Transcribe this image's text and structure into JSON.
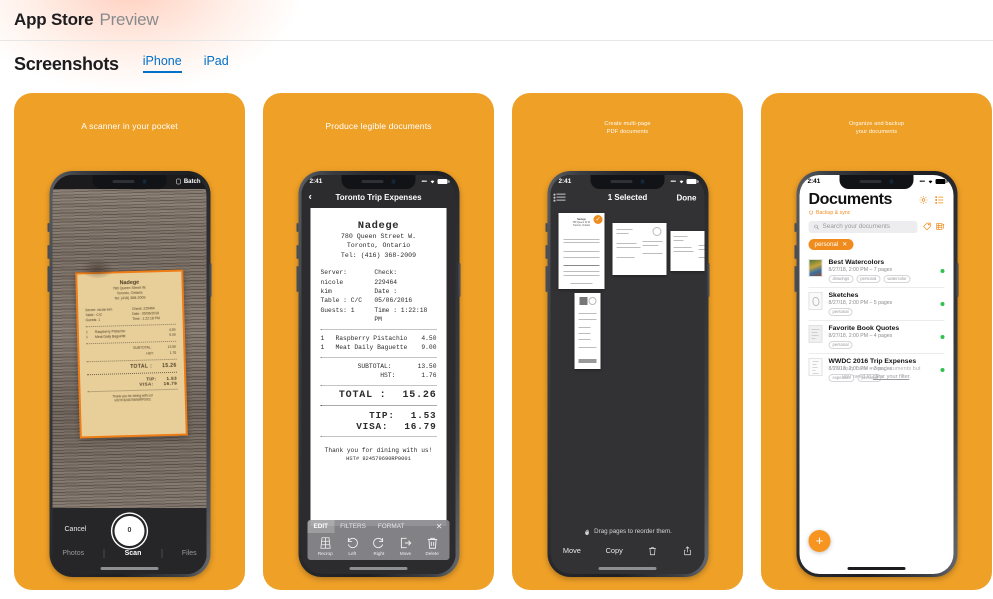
{
  "header": {
    "brand": "App Store",
    "section": "Preview"
  },
  "screenshots_section": {
    "title": "Screenshots",
    "tabs": [
      {
        "label": "iPhone",
        "active": true
      },
      {
        "label": "iPad",
        "active": false
      }
    ]
  },
  "theme": {
    "brand_orange": "#EFA027",
    "accent_orange": "#F08C1E",
    "link_blue": "#0070C9",
    "status_green": "#2FC04F"
  },
  "cards": [
    {
      "caption": "A scanner in your pocket",
      "screen": {
        "type": "camera-scanner",
        "topbar_button": "Batch",
        "cancel_label": "Cancel",
        "shutter_count": "0",
        "tabs": [
          "Photos",
          "Scan",
          "Files"
        ],
        "active_tab": "Scan",
        "receipt": {
          "title": "Nadege",
          "address1": "780 Queen Street W.",
          "address2": "Toronto, Ontario",
          "phone": "Tel: (416) 368-2009",
          "server": "Server: nicole kim",
          "table": "Table : C/C",
          "guests": "Guests: 1",
          "check": "Check: 229464",
          "date": "Date : 05/06/2016",
          "time": "Time : 1:22:18 PM",
          "items": [
            {
              "qty": "1",
              "name": "Raspberry Pistachio",
              "price": "4.50"
            },
            {
              "qty": "1",
              "name": "Meat Daily Baguette",
              "price": "9.00"
            }
          ],
          "subtotal_label": "SUBTOTAL:",
          "subtotal": "13.50",
          "hst_label": "HST:",
          "hst": "1.76",
          "total_label": "TOTAL :",
          "total": "15.26",
          "tip_label": "TIP:",
          "tip": "1.53",
          "visa_label": "VISA:",
          "visa": "16.79",
          "thanks": "Thank you for dining with us!",
          "hst_number": "HST# 824579690RP0001"
        }
      }
    },
    {
      "caption": "Produce legible documents",
      "screen": {
        "type": "document-viewer",
        "status_time": "2:41",
        "nav_title": "Toronto Trip Expenses",
        "toolbar_tabs": [
          "EDIT",
          "FILTERS",
          "FORMAT"
        ],
        "toolbar_active": "EDIT",
        "toolbar_actions": [
          {
            "label": "Recrop",
            "icon": "crop-icon"
          },
          {
            "label": "Left",
            "icon": "rotate-left-icon"
          },
          {
            "label": "Right",
            "icon": "rotate-right-icon"
          },
          {
            "label": "Move",
            "icon": "move-icon"
          },
          {
            "label": "Delete",
            "icon": "trash-icon"
          }
        ],
        "receipt": {
          "title": "Nadege",
          "address1": "780 Queen Street W.",
          "address2": "Toronto, Ontario",
          "phone": "Tel: (416) 368-2009",
          "server": "Server: nicole kim",
          "table": "Table : C/C",
          "guests": "Guests: 1",
          "check": "Check: 229464",
          "date": "Date : 05/06/2016",
          "time": "Time : 1:22:18 PM",
          "items": [
            {
              "qty": "1",
              "name": "Raspberry Pistachio",
              "price": "4.50"
            },
            {
              "qty": "1",
              "name": "Meat Daily Baguette",
              "price": "9.00"
            }
          ],
          "subtotal_label": "SUBTOTAL:",
          "subtotal": "13.50",
          "hst_label": "HST:",
          "hst": "1.76",
          "total_label": "TOTAL :",
          "total": "15.26",
          "tip_label": "TIP:",
          "tip": "1.53",
          "visa_label": "VISA:",
          "visa": "16.79",
          "thanks": "Thank you for dining with us!",
          "hst_number": "HST# 824579690RP0001"
        }
      }
    },
    {
      "caption": "Create multi-page\nPDF documents",
      "caption_line1": "Create multi-page",
      "caption_line2": "PDF documents",
      "screen": {
        "type": "pages-grid",
        "status_time": "2:41",
        "nav_title": "1 Selected",
        "done_label": "Done",
        "hint": "Drag pages to reorder them.",
        "bottom_actions": [
          "Move",
          "Copy"
        ],
        "page_count": 4,
        "selected_index": 0
      }
    },
    {
      "caption": "Organize and backup\nyour documents",
      "caption_line1": "Organize and backup",
      "caption_line2": "your documents",
      "screen": {
        "type": "documents-list",
        "status_time": "2:41",
        "title": "Documents",
        "sync_label": "Backup & sync",
        "search_placeholder": "Search your documents",
        "filter_chip": "personal",
        "documents": [
          {
            "name": "Best Watercolors",
            "meta": "8/27/18, 2:00 PM – 7 pages",
            "tags": [
              "drawings",
              "personal",
              "watercolor"
            ]
          },
          {
            "name": "Sketches",
            "meta": "8/27/18, 2:00 PM – 5 pages",
            "tags": [
              "personal"
            ]
          },
          {
            "name": "Favorite Book Quotes",
            "meta": "8/27/18, 2:00 PM – 4 pages",
            "tags": [
              "personal"
            ]
          },
          {
            "name": "WWDC 2016 Trip Expenses",
            "meta": "8/27/18, 2:00 PM – 3 pages",
            "tags": [
              "expenses",
              "personal"
            ]
          }
        ],
        "empty_note_line1": "You may have more documents but",
        "empty_note_line2_pre": "you need to ",
        "empty_note_link": "clear your filter",
        "empty_note_line2_post": ".",
        "fab_label": "+"
      }
    }
  ]
}
